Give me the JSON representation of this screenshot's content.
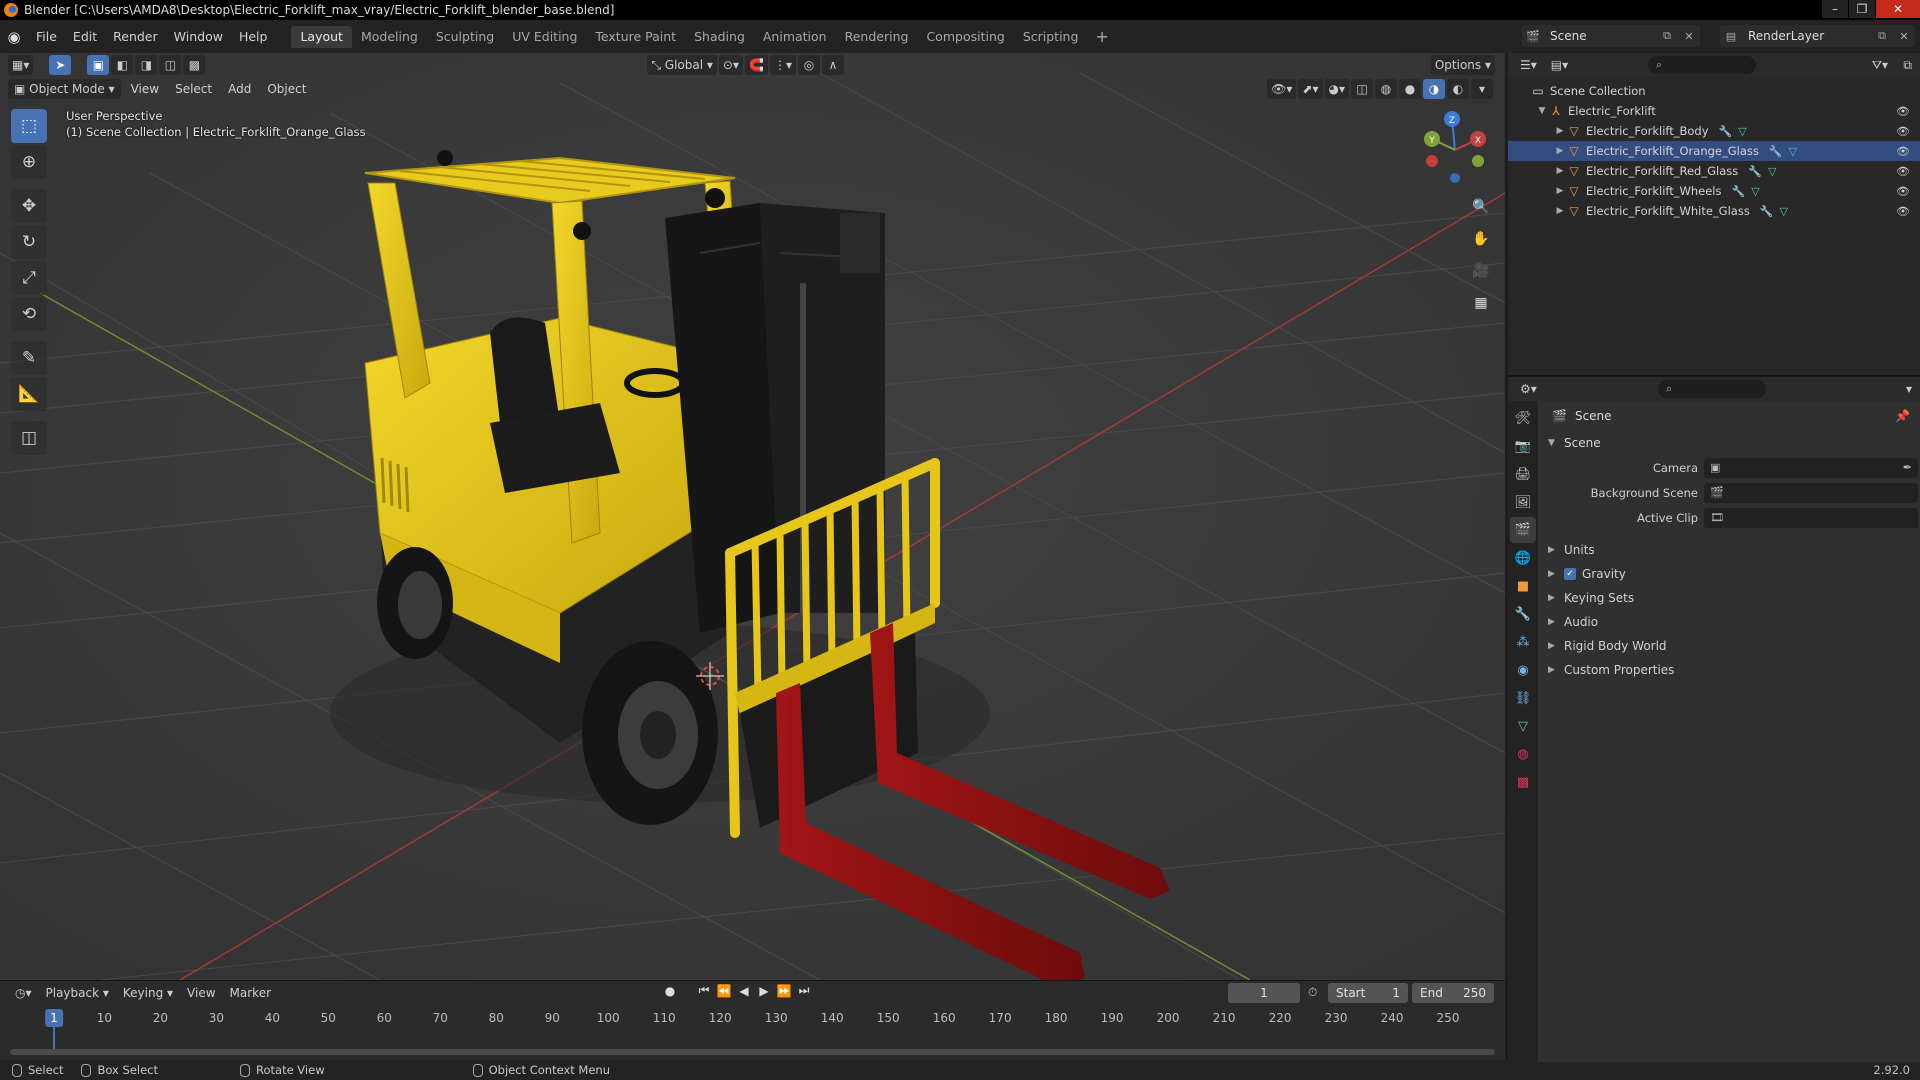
{
  "window": {
    "title": "Blender [C:\\Users\\AMDA8\\Desktop\\Electric_Forklift_max_vray/Electric_Forklift_blender_base.blend]",
    "minimize": "–",
    "maximize": "❐",
    "close": "✕"
  },
  "menu": {
    "items": [
      "File",
      "Edit",
      "Render",
      "Window",
      "Help"
    ]
  },
  "workspaces": {
    "tabs": [
      "Layout",
      "Modeling",
      "Sculpting",
      "UV Editing",
      "Texture Paint",
      "Shading",
      "Animation",
      "Rendering",
      "Compositing",
      "Scripting"
    ],
    "active": "Layout",
    "add": "+"
  },
  "scene_selector": {
    "label": "Scene"
  },
  "view_layer_selector": {
    "label": "RenderLayer"
  },
  "viewport": {
    "mode": "Object Mode",
    "menus": [
      "View",
      "Select",
      "Add",
      "Object"
    ],
    "transform_orientation": "Global",
    "options": "Options",
    "overlay_line1": "User Perspective",
    "overlay_line2": "(1) Scene Collection | Electric_Forklift_Orange_Glass",
    "gizmo_axes": {
      "x": "X",
      "y": "Y",
      "z": "Z"
    }
  },
  "timeline": {
    "menus": [
      "Playback",
      "Keying",
      "View",
      "Marker"
    ],
    "current_frame": "1",
    "start_label": "Start",
    "start_value": "1",
    "end_label": "End",
    "end_value": "250",
    "ticks": [
      "1",
      "10",
      "20",
      "30",
      "40",
      "50",
      "60",
      "70",
      "80",
      "90",
      "100",
      "110",
      "120",
      "130",
      "140",
      "150",
      "160",
      "170",
      "180",
      "190",
      "200",
      "210",
      "220",
      "230",
      "240",
      "250"
    ],
    "cursor": "1"
  },
  "statusbar": {
    "select": "Select",
    "box_select": "Box Select",
    "rotate_view": "Rotate View",
    "context_menu": "Object Context Menu",
    "version": "2.92.0"
  },
  "outliner": {
    "root": "Scene Collection",
    "collection": "Electric_Forklift",
    "objects": [
      "Electric_Forklift_Body",
      "Electric_Forklift_Orange_Glass",
      "Electric_Forklift_Red_Glass",
      "Electric_Forklift_Wheels",
      "Electric_Forklift_White_Glass"
    ]
  },
  "properties": {
    "context": "Scene",
    "panel_scene": "Scene",
    "camera_label": "Camera",
    "background_scene_label": "Background Scene",
    "active_clip_label": "Active Clip",
    "panels": [
      "Units",
      "Gravity",
      "Keying Sets",
      "Audio",
      "Rigid Body World",
      "Custom Properties"
    ],
    "gravity_checked": true
  },
  "colors": {
    "accent": "#4772b3",
    "forklift_yellow": "#e6c619",
    "fork_red": "#8a1010",
    "axis_x": "#c2413f",
    "axis_y": "#7fa33a",
    "axis_z": "#3d7ad8"
  }
}
